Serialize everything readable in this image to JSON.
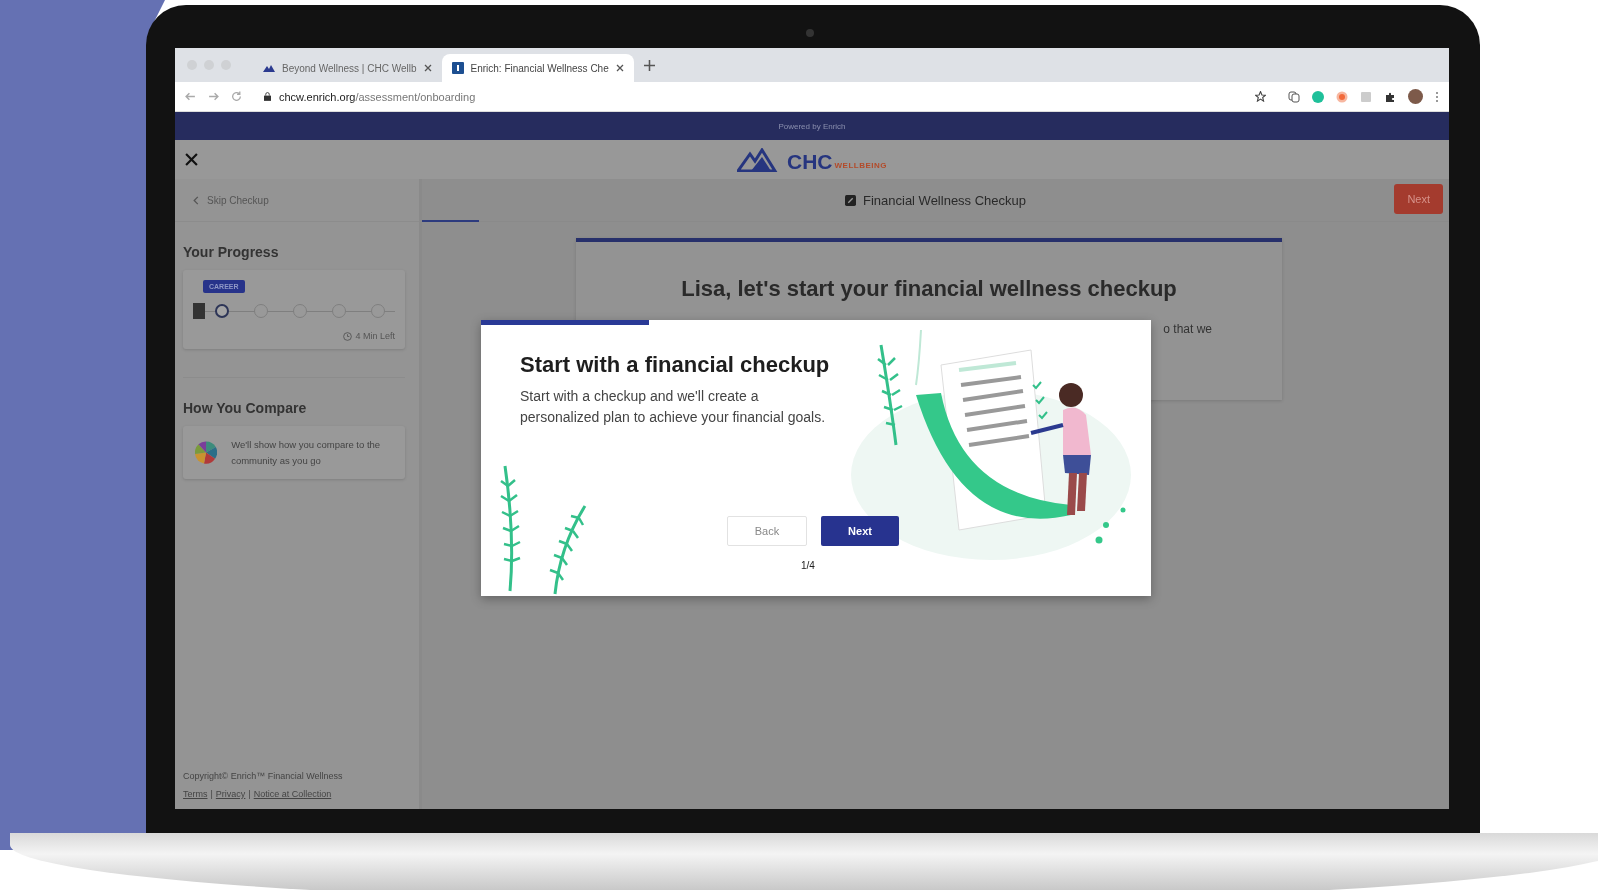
{
  "browser": {
    "tabs": [
      {
        "title": "Beyond Wellness | CHC Wellb",
        "selected": false
      },
      {
        "title": "Enrich: Financial Wellness Che",
        "selected": true
      }
    ],
    "url_host": "chcw.enrich.org",
    "url_path": "/assessment/onboarding"
  },
  "banner": {
    "text": "Powered by Enrich"
  },
  "header": {
    "logo": "CHC",
    "logo_sub": "WELLBEING"
  },
  "sidebar": {
    "back_link": "Skip Checkup",
    "progress_title": "Your Progress",
    "progress_badge": "CAREER",
    "progress_steps": [
      {
        "current": true
      },
      {
        "current": false
      },
      {
        "current": false
      },
      {
        "current": false
      },
      {
        "current": false
      }
    ],
    "time_left": "4 Min Left",
    "compare_title": "How You Compare",
    "compare_text": "We'll show how you compare to the community as you go",
    "copyright": "Copyright© Enrich™ Financial Wellness",
    "links": [
      "Terms",
      "Privacy",
      "Notice at Collection"
    ],
    "link_separator": "|"
  },
  "toolbar": {
    "title": "Financial Wellness Checkup",
    "next_button": "Next"
  },
  "card": {
    "heading": "Lisa, let's start your financial wellness checkup",
    "text_fragment": "o that we"
  },
  "modal": {
    "level": 0.25,
    "title": "Start with a financial checkup",
    "body": "Start with a checkup and we'll create a personalized plan to achieve your financial goals.",
    "back_button": "Back",
    "next_button": "Next",
    "page": "1/4"
  }
}
